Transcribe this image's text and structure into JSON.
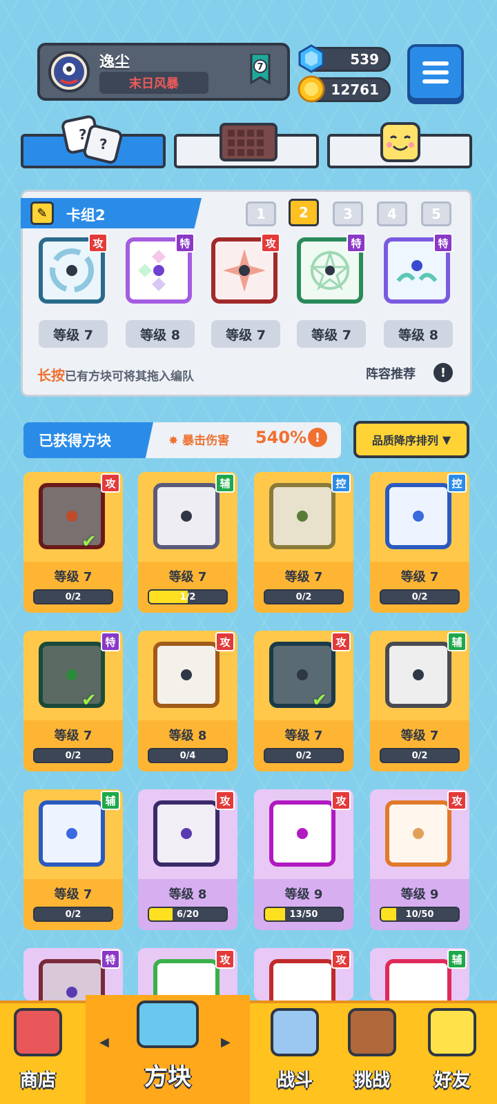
{
  "player": {
    "name": "逸尘",
    "title": "末日风暴",
    "rank": "7"
  },
  "resources": {
    "gems": "539",
    "coins": "12761"
  },
  "deck": {
    "label": "卡组2",
    "numbers": [
      "1",
      "2",
      "3",
      "4",
      "5"
    ],
    "selected": 1,
    "cards": [
      {
        "tag": "攻",
        "level": "等级 7"
      },
      {
        "tag": "特",
        "level": "等级 8"
      },
      {
        "tag": "攻",
        "level": "等级 7"
      },
      {
        "tag": "特",
        "level": "等级 7"
      },
      {
        "tag": "特",
        "level": "等级 8"
      }
    ],
    "hint_bold": "长按",
    "hint_rest": "已有方块可将其拖入编队",
    "recommend": "阵容推荐"
  },
  "owned": {
    "title": "已获得方块",
    "crit_label": "暴击伤害",
    "crit_value": "540%",
    "sort_label": "品质降序排列",
    "cards": [
      {
        "tag": "攻",
        "level": "等级 7",
        "progress": "0/2",
        "fill": 0,
        "check": true
      },
      {
        "tag": "辅",
        "level": "等级 7",
        "progress": "1/2",
        "fill": 0.5,
        "check": false
      },
      {
        "tag": "控",
        "level": "等级 7",
        "progress": "0/2",
        "fill": 0,
        "check": false
      },
      {
        "tag": "控",
        "level": "等级 7",
        "progress": "0/2",
        "fill": 0,
        "check": false
      },
      {
        "tag": "特",
        "level": "等级 7",
        "progress": "0/2",
        "fill": 0,
        "check": true
      },
      {
        "tag": "攻",
        "level": "等级 8",
        "progress": "0/4",
        "fill": 0,
        "check": false
      },
      {
        "tag": "攻",
        "level": "等级 7",
        "progress": "0/2",
        "fill": 0,
        "check": true
      },
      {
        "tag": "辅",
        "level": "等级 7",
        "progress": "0/2",
        "fill": 0,
        "check": false
      },
      {
        "tag": "辅",
        "level": "等级 7",
        "progress": "0/2",
        "fill": 0,
        "check": false
      },
      {
        "tag": "攻",
        "level": "等级 8",
        "progress": "6/20",
        "fill": 0.3,
        "check": false
      },
      {
        "tag": "攻",
        "level": "等级 9",
        "progress": "13/50",
        "fill": 0.26,
        "check": false
      },
      {
        "tag": "攻",
        "level": "等级 9",
        "progress": "10/50",
        "fill": 0.2,
        "check": false
      }
    ],
    "partial_tags": [
      "特",
      "攻",
      "攻",
      "辅"
    ]
  },
  "nav": [
    {
      "label": "商店"
    },
    {
      "label": "方块"
    },
    {
      "label": "战斗"
    },
    {
      "label": "挑战"
    },
    {
      "label": "好友"
    }
  ],
  "colors": {
    "accent": "#2b8ce8",
    "gold": "#ffc84a",
    "purple": "#e8c8f5",
    "nav": "#ffc21e"
  }
}
